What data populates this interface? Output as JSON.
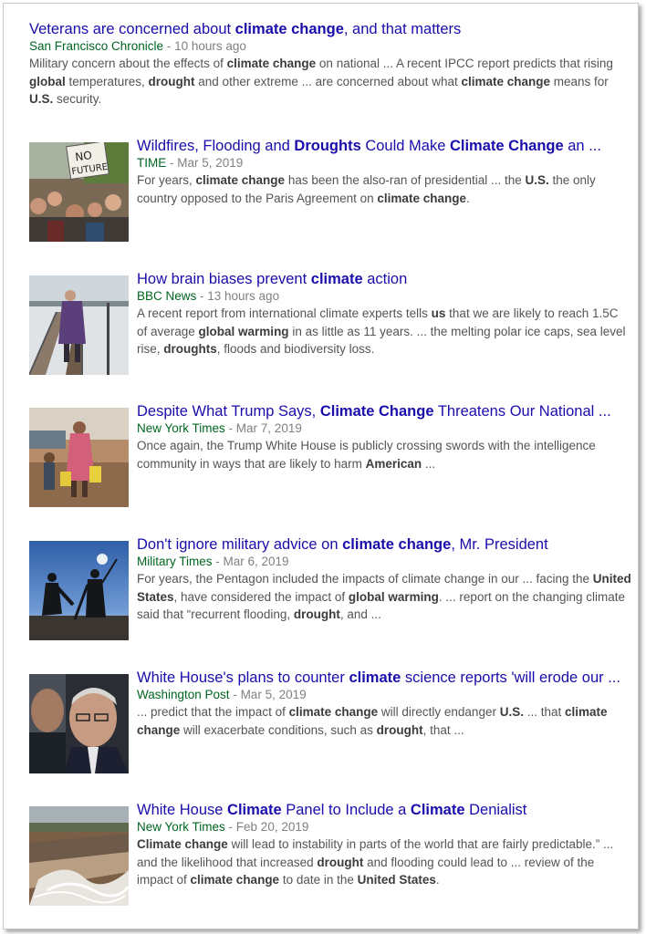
{
  "results": [
    {
      "title_parts": [
        {
          "t": "Veterans are concerned about ",
          "b": false
        },
        {
          "t": "climate change",
          "b": true
        },
        {
          "t": ", and that matters",
          "b": false
        }
      ],
      "source": "San Francisco Chronicle",
      "separator": " - ",
      "date": "10 hours ago",
      "snippet_parts": [
        {
          "t": "Military concern about the effects of ",
          "b": false
        },
        {
          "t": "climate change",
          "b": true
        },
        {
          "t": " on national ... A recent IPCC report predicts that rising ",
          "b": false
        },
        {
          "t": "global",
          "b": true
        },
        {
          "t": " temperatures, ",
          "b": false
        },
        {
          "t": "drought",
          "b": true
        },
        {
          "t": " and other extreme ... are concerned about what ",
          "b": false
        },
        {
          "t": "climate change",
          "b": true
        },
        {
          "t": " means for ",
          "b": false
        },
        {
          "t": "U.S.",
          "b": true
        },
        {
          "t": " security.",
          "b": false
        }
      ],
      "thumbnail": null
    },
    {
      "title_parts": [
        {
          "t": "Wildfires, Flooding and ",
          "b": false
        },
        {
          "t": "Droughts",
          "b": true
        },
        {
          "t": " Could Make ",
          "b": false
        },
        {
          "t": "Climate Change",
          "b": true
        },
        {
          "t": " an ...",
          "b": false
        }
      ],
      "source": "TIME",
      "separator": " - ",
      "date": "Mar 5, 2019",
      "snippet_parts": [
        {
          "t": "For years, ",
          "b": false
        },
        {
          "t": "climate change",
          "b": true
        },
        {
          "t": " has been the also-ran of presidential ... the ",
          "b": false
        },
        {
          "t": "U.S.",
          "b": true
        },
        {
          "t": " the only country opposed to the Paris Agreement on ",
          "b": false
        },
        {
          "t": "climate change",
          "b": true
        },
        {
          "t": ".",
          "b": false
        }
      ],
      "thumbnail": "protest-crowd-photo",
      "thumbnail_sign_text": [
        "NO",
        "FUTURE"
      ]
    },
    {
      "title_parts": [
        {
          "t": "How brain biases prevent ",
          "b": false
        },
        {
          "t": "climate",
          "b": true
        },
        {
          "t": " action",
          "b": false
        }
      ],
      "source": "BBC News",
      "separator": " - ",
      "date": "13 hours ago",
      "snippet_parts": [
        {
          "t": "A recent report from international climate experts tells ",
          "b": false
        },
        {
          "t": "us",
          "b": true
        },
        {
          "t": " that we are likely to reach 1.5C of average ",
          "b": false
        },
        {
          "t": "global warming",
          "b": true
        },
        {
          "t": " in as little as 11 years. ... the melting polar ice caps, sea level rise, ",
          "b": false
        },
        {
          "t": "droughts",
          "b": true
        },
        {
          "t": ", floods and biodiversity loss.",
          "b": false
        }
      ],
      "thumbnail": "snow-railway-photo"
    },
    {
      "title_parts": [
        {
          "t": "Despite What Trump Says, ",
          "b": false
        },
        {
          "t": "Climate Change",
          "b": true
        },
        {
          "t": " Threatens Our National ...",
          "b": false
        }
      ],
      "source": "New York Times",
      "separator": " - ",
      "date": "Mar 7, 2019",
      "snippet_parts": [
        {
          "t": "Once again, the Trump White House is publicly crossing swords with the intelligence community in ways that are likely to harm ",
          "b": false
        },
        {
          "t": "American",
          "b": true
        },
        {
          "t": " ...",
          "b": false
        }
      ],
      "thumbnail": "water-carrying-photo"
    },
    {
      "title_parts": [
        {
          "t": "Don't ignore military advice on ",
          "b": false
        },
        {
          "t": "climate change",
          "b": true
        },
        {
          "t": ", Mr. President",
          "b": false
        }
      ],
      "source": "Military Times",
      "separator": " - ",
      "date": "Mar 6, 2019",
      "snippet_parts": [
        {
          "t": "For years, the Pentagon included the impacts of climate change in our ... facing the ",
          "b": false
        },
        {
          "t": "United States",
          "b": true
        },
        {
          "t": ", have considered the impact of ",
          "b": false
        },
        {
          "t": "global warming",
          "b": true
        },
        {
          "t": ". ... report on the changing climate said that “recurrent flooding, ",
          "b": false
        },
        {
          "t": "drought",
          "b": true
        },
        {
          "t": ", and ...",
          "b": false
        }
      ],
      "thumbnail": "soldiers-silhouette-photo"
    },
    {
      "title_parts": [
        {
          "t": "White House's plans to counter ",
          "b": false
        },
        {
          "t": "climate",
          "b": true
        },
        {
          "t": " science reports 'will erode our ...",
          "b": false
        }
      ],
      "source": "Washington Post",
      "separator": " - ",
      "date": "Mar 5, 2019",
      "snippet_parts": [
        {
          "t": "... predict that the impact of ",
          "b": false
        },
        {
          "t": "climate change",
          "b": true
        },
        {
          "t": " will directly endanger ",
          "b": false
        },
        {
          "t": "U.S.",
          "b": true
        },
        {
          "t": " ... that ",
          "b": false
        },
        {
          "t": "climate change",
          "b": true
        },
        {
          "t": " will exacerbate conditions, such as ",
          "b": false
        },
        {
          "t": "drought",
          "b": true
        },
        {
          "t": ", that ...",
          "b": false
        }
      ],
      "thumbnail": "officials-portrait-photo"
    },
    {
      "title_parts": [
        {
          "t": "White House ",
          "b": false
        },
        {
          "t": "Climate",
          "b": true
        },
        {
          "t": " Panel to Include a ",
          "b": false
        },
        {
          "t": "Climate",
          "b": true
        },
        {
          "t": " Denialist",
          "b": false
        }
      ],
      "source": "New York Times",
      "separator": " - ",
      "date": "Feb 20, 2019",
      "snippet_parts": [
        {
          "t": "Climate change",
          "b": true
        },
        {
          "t": " will lead to instability in parts of the world that are fairly predictable.” ... and the likelihood that increased ",
          "b": false
        },
        {
          "t": "drought",
          "b": true
        },
        {
          "t": " and flooding could lead to ... review of the impact of ",
          "b": false
        },
        {
          "t": "climate change",
          "b": true
        },
        {
          "t": " to date in the ",
          "b": false
        },
        {
          "t": "United States",
          "b": true
        },
        {
          "t": ".",
          "b": false
        }
      ],
      "thumbnail": "flood-aerial-photo"
    }
  ]
}
